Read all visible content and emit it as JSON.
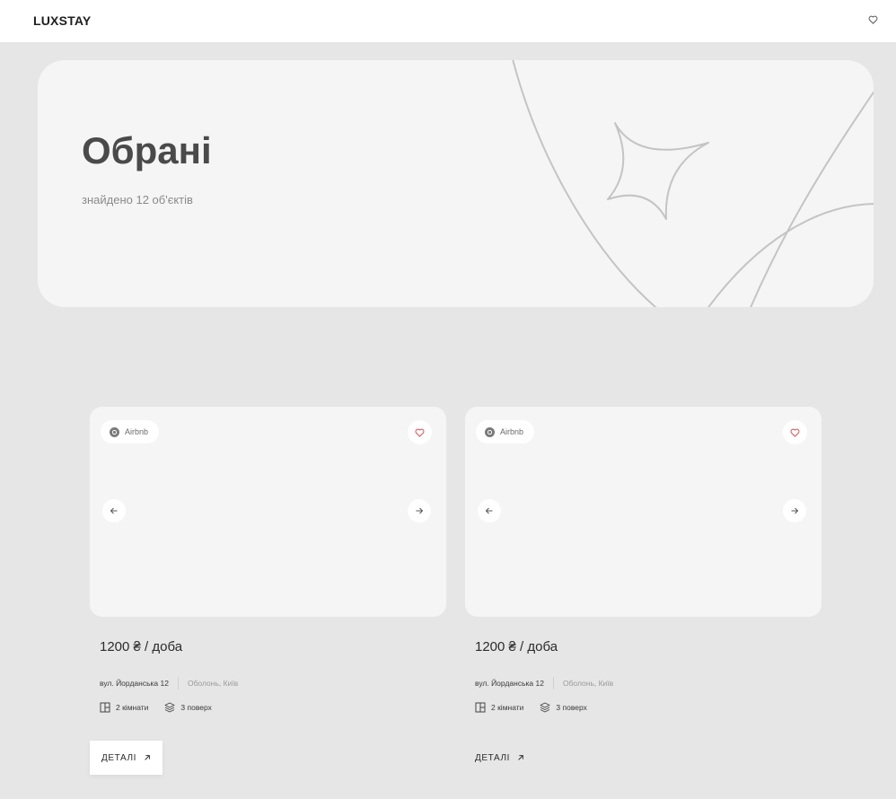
{
  "header": {
    "logo": "LUXSTAY",
    "favorites_icon": "heart-outline-icon"
  },
  "hero": {
    "title": "Обрані",
    "subtitle": "знайдено 12 об'єктів"
  },
  "colors": {
    "favorite_accent": "#e0555d",
    "background": "#e6e6e6",
    "card": "#f5f5f5"
  },
  "listings": [
    {
      "source": "Airbnb",
      "price": "1200 ₴ / доба",
      "street": "вул. Йорданська 12",
      "district": "Оболонь, Київ",
      "rooms": "2 кімнати",
      "floor": "3 поверх",
      "details_label": "ДЕТАЛІ",
      "prev_icon": "arrow-left-icon",
      "next_icon": "arrow-right-icon",
      "favorite": true
    },
    {
      "source": "Airbnb",
      "price": "1200 ₴ / доба",
      "street": "вул. Йорданська 12",
      "district": "Оболонь, Київ",
      "rooms": "2 кімнати",
      "floor": "3 поверх",
      "details_label": "ДЕТАЛІ",
      "prev_icon": "arrow-left-icon",
      "next_icon": "arrow-right-icon",
      "favorite": true
    }
  ]
}
